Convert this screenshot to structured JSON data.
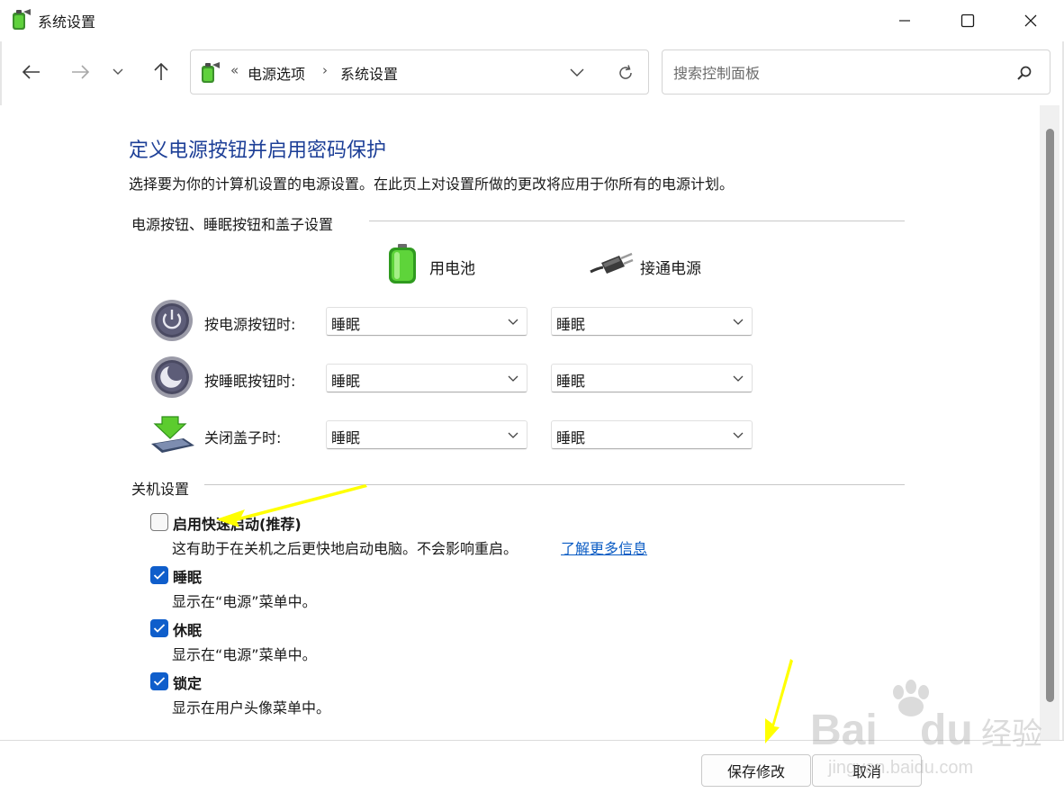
{
  "window": {
    "title": "系统设置"
  },
  "address_bar": {
    "separator_start": "«",
    "crumbs": [
      "电源选项",
      "系统设置"
    ],
    "separator": "›"
  },
  "search": {
    "placeholder": "搜索控制面板",
    "value": ""
  },
  "page": {
    "heading": "定义电源按钮并启用密码保护",
    "description": "选择要为你的计算机设置的电源设置。在此页上对设置所做的更改将应用于你所有的电源计划。"
  },
  "power_section": {
    "title": "电源按钮、睡眠按钮和盖子设置",
    "columns": {
      "battery": "用电池",
      "plugged_in": "接通电源"
    },
    "rows": [
      {
        "label": "按电源按钮时:",
        "icon": "power-icon",
        "battery": "睡眠",
        "plugged_in": "睡眠"
      },
      {
        "label": "按睡眠按钮时:",
        "icon": "sleep-icon",
        "battery": "睡眠",
        "plugged_in": "睡眠"
      },
      {
        "label": "关闭盖子时:",
        "icon": "laptop-lid-icon",
        "battery": "睡眠",
        "plugged_in": "睡眠"
      }
    ]
  },
  "shutdown_section": {
    "title": "关机设置",
    "options": [
      {
        "label": "启用快速启动(推荐)",
        "checked": false,
        "description": "这有助于在关机之后更快地启动电脑。不会影响重启。",
        "link": "了解更多信息"
      },
      {
        "label": "睡眠",
        "checked": true,
        "description": "显示在“电源”菜单中。"
      },
      {
        "label": "休眠",
        "checked": true,
        "description": "显示在“电源”菜单中。"
      },
      {
        "label": "锁定",
        "checked": true,
        "description": "显示在用户头像菜单中。"
      }
    ]
  },
  "footer": {
    "save_label": "保存修改",
    "cancel_label": "取消"
  },
  "colors": {
    "heading": "#1d3f97",
    "checkbox_on": "#0f5ecb",
    "link": "#0b5cc4",
    "annotation_arrow": "#ffff00"
  }
}
